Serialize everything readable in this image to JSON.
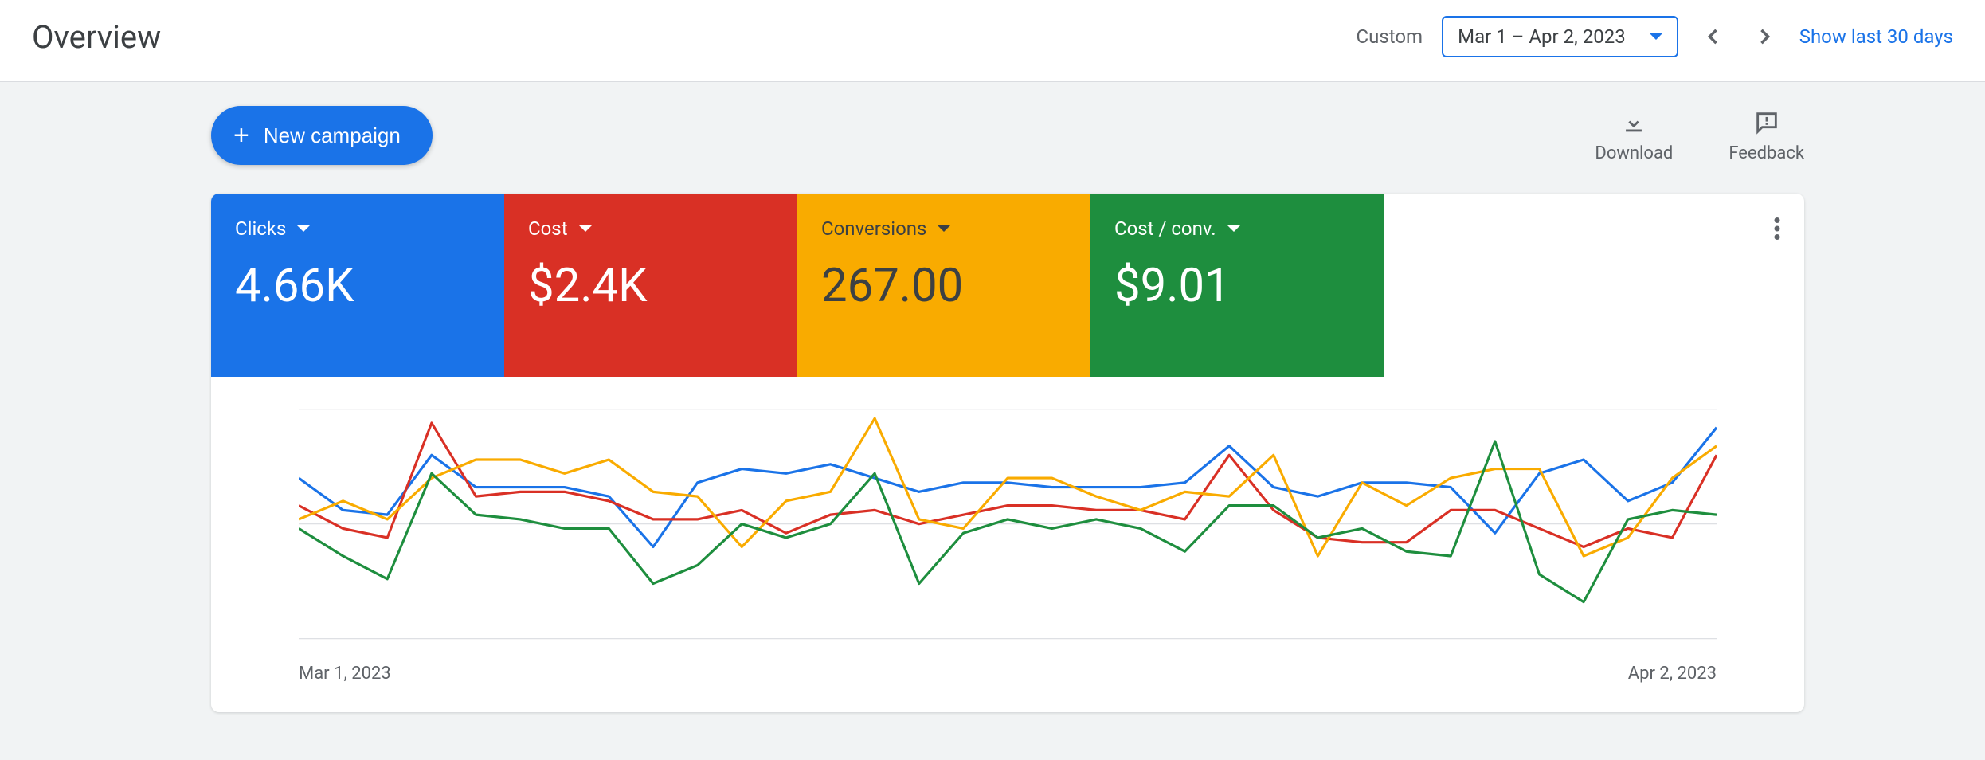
{
  "header": {
    "title": "Overview",
    "custom_label": "Custom",
    "date_range": "Mar 1 – Apr 2, 2023",
    "show_last": "Show last 30 days"
  },
  "actions": {
    "new_campaign": "New campaign",
    "download": "Download",
    "feedback": "Feedback"
  },
  "metrics": [
    {
      "label": "Clicks",
      "value": "4.66K",
      "color": "#1a73e8"
    },
    {
      "label": "Cost",
      "value": "$2.4K",
      "color": "#d93025"
    },
    {
      "label": "Conversions",
      "value": "267.00",
      "color": "#f9ab00"
    },
    {
      "label": "Cost / conv.",
      "value": "$9.01",
      "color": "#1e8e3e"
    }
  ],
  "chart_axis": {
    "start": "Mar 1, 2023",
    "end": "Apr 2, 2023"
  },
  "chart_data": {
    "type": "line",
    "xlabel": "",
    "ylabel": "",
    "x_range": [
      "Mar 1, 2023",
      "Apr 2, 2023"
    ],
    "y_range_normalized": [
      0,
      100
    ],
    "categories": [
      "Mar 1",
      "Mar 2",
      "Mar 3",
      "Mar 4",
      "Mar 5",
      "Mar 6",
      "Mar 7",
      "Mar 8",
      "Mar 9",
      "Mar 10",
      "Mar 11",
      "Mar 12",
      "Mar 13",
      "Mar 14",
      "Mar 15",
      "Mar 16",
      "Mar 17",
      "Mar 18",
      "Mar 19",
      "Mar 20",
      "Mar 21",
      "Mar 22",
      "Mar 23",
      "Mar 24",
      "Mar 25",
      "Mar 26",
      "Mar 27",
      "Mar 28",
      "Mar 29",
      "Mar 30",
      "Mar 31",
      "Apr 1",
      "Apr 2"
    ],
    "series": [
      {
        "name": "Clicks",
        "color": "#1a73e8",
        "values": [
          70,
          56,
          54,
          80,
          66,
          66,
          66,
          62,
          40,
          68,
          74,
          72,
          76,
          70,
          64,
          68,
          68,
          66,
          66,
          66,
          68,
          84,
          66,
          62,
          68,
          68,
          66,
          46,
          72,
          78,
          60,
          68,
          92
        ]
      },
      {
        "name": "Cost",
        "color": "#d93025",
        "values": [
          58,
          48,
          44,
          94,
          62,
          64,
          64,
          60,
          52,
          52,
          56,
          46,
          54,
          56,
          50,
          54,
          58,
          58,
          56,
          56,
          52,
          80,
          56,
          44,
          42,
          42,
          56,
          56,
          48,
          40,
          48,
          44,
          80
        ]
      },
      {
        "name": "Conversions",
        "color": "#f9ab00",
        "values": [
          52,
          60,
          52,
          70,
          78,
          78,
          72,
          78,
          64,
          62,
          40,
          60,
          64,
          96,
          52,
          48,
          70,
          70,
          62,
          56,
          64,
          62,
          80,
          36,
          68,
          58,
          70,
          74,
          74,
          36,
          44,
          70,
          84
        ]
      },
      {
        "name": "Cost / conv.",
        "color": "#1e8e3e",
        "values": [
          48,
          36,
          26,
          72,
          54,
          52,
          48,
          48,
          24,
          32,
          50,
          44,
          50,
          72,
          24,
          46,
          52,
          48,
          52,
          48,
          38,
          58,
          58,
          44,
          48,
          38,
          36,
          86,
          28,
          16,
          52,
          56,
          54
        ]
      }
    ]
  }
}
